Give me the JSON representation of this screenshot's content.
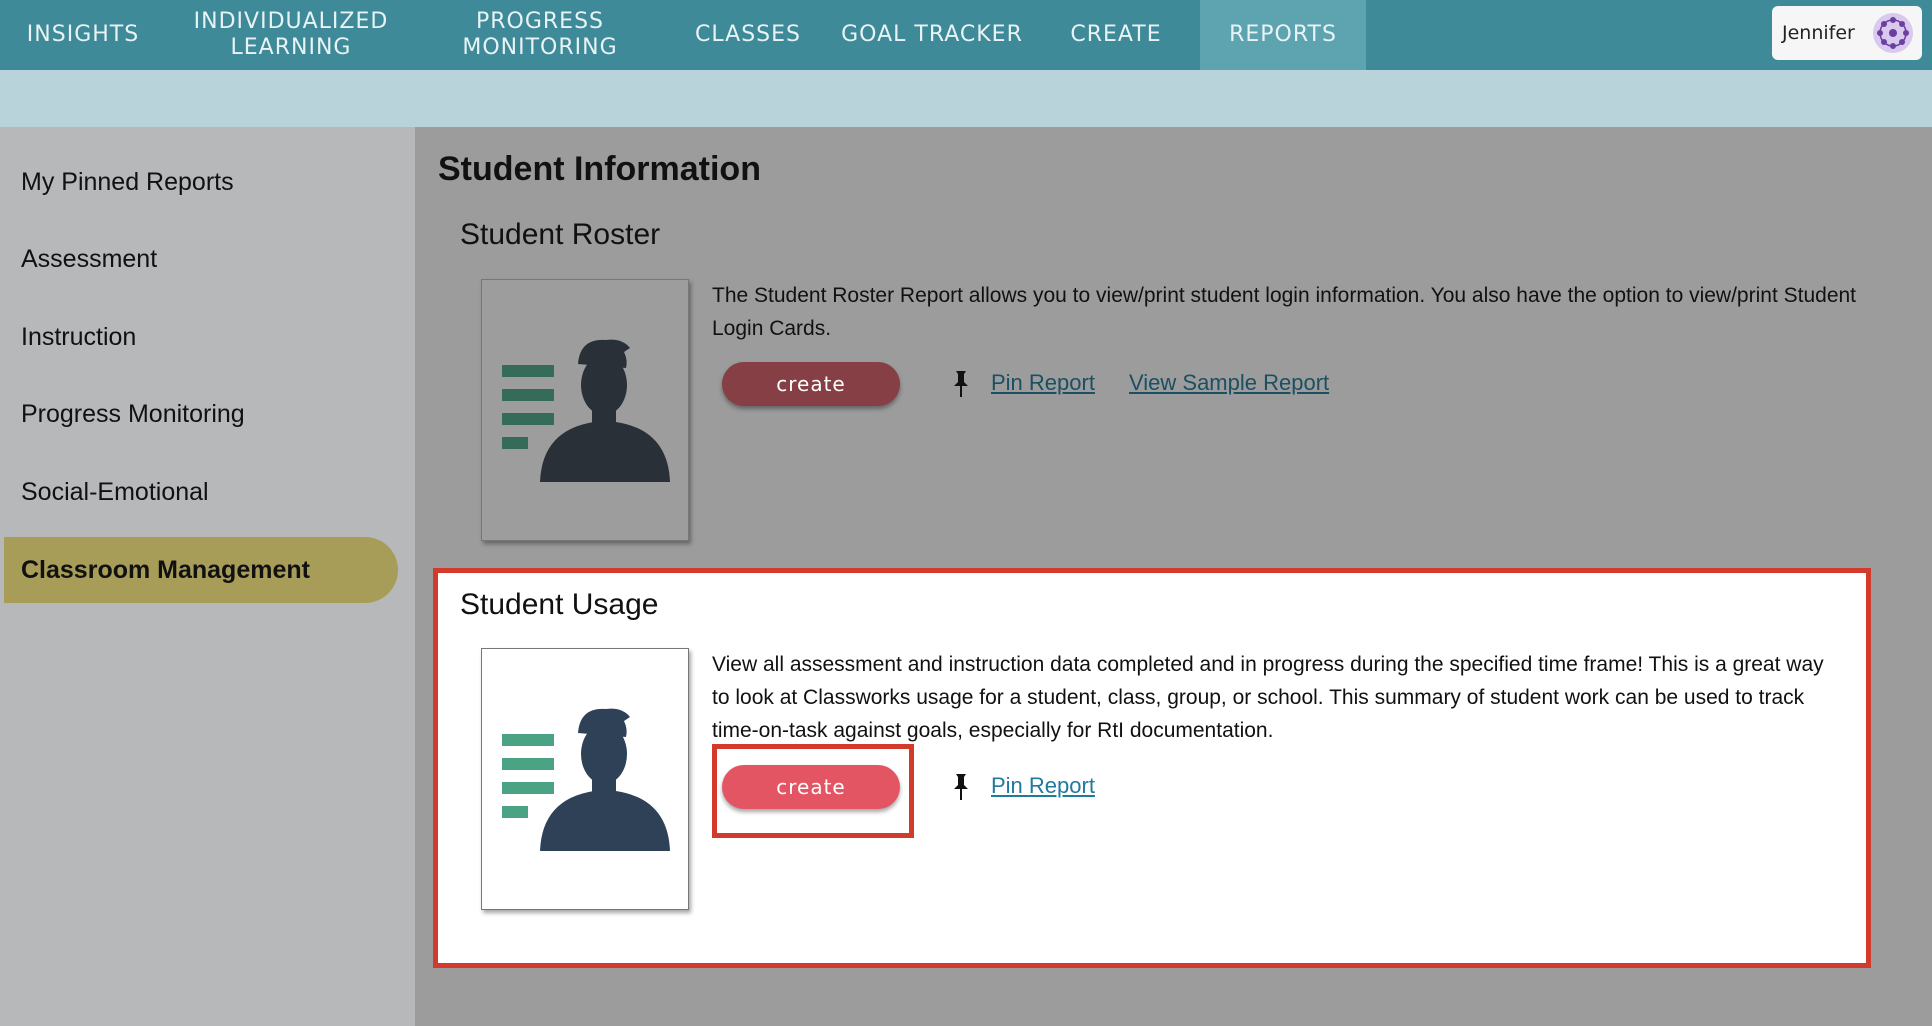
{
  "nav": {
    "items": [
      {
        "label": "INSIGHTS",
        "name": "nav-insights"
      },
      {
        "label": "INDIVIDUALIZED\nLEARNING",
        "name": "nav-individualized-learning"
      },
      {
        "label": "PROGRESS\nMONITORING",
        "name": "nav-progress-monitoring"
      },
      {
        "label": "CLASSES",
        "name": "nav-classes"
      },
      {
        "label": "GOAL TRACKER",
        "name": "nav-goal-tracker"
      },
      {
        "label": "CREATE",
        "name": "nav-create"
      },
      {
        "label": "REPORTS",
        "name": "nav-reports"
      }
    ],
    "active": "REPORTS",
    "user": {
      "name": "Jennifer",
      "avatar_icon": "avatar-pattern-icon"
    }
  },
  "sidebar": {
    "items": [
      {
        "label": "My Pinned Reports"
      },
      {
        "label": "Assessment"
      },
      {
        "label": "Instruction"
      },
      {
        "label": "Progress Monitoring"
      },
      {
        "label": "Social-Emotional"
      },
      {
        "label": "Classroom Management"
      }
    ],
    "active": "Classroom Management"
  },
  "main": {
    "section_title": "Student Information",
    "reports": [
      {
        "title": "Student Roster",
        "description": "The Student Roster Report allows you to view/print student login information. You also have the option to view/print Student Login Cards.",
        "create_label": "create",
        "pin_label": "Pin Report",
        "sample_label": "View Sample Report",
        "thumbnail_icon": "student-report-icon"
      },
      {
        "title": "Student Usage",
        "description": "View all assessment and instruction data completed and in progress during the specified time frame! This is a great way to look at Classworks usage for a student, class, group, or school. This summary of student work can be used to track time-on-task against goals, especially for RtI documentation.",
        "create_label": "create",
        "pin_label": "Pin Report",
        "thumbnail_icon": "student-report-icon"
      }
    ]
  },
  "colors": {
    "nav_bg": "#3e8a99",
    "accent_red": "#d23a2b",
    "button_red": "#e35563",
    "active_sidebar": "#a79d58",
    "icon_navy": "#2f4157",
    "icon_green": "#4aa383",
    "link_blue": "#1f7a9c"
  }
}
